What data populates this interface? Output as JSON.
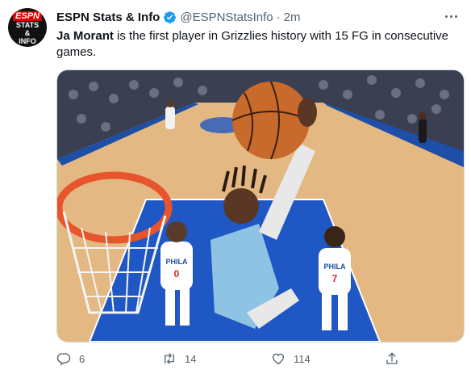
{
  "account": {
    "avatar_text_top": "ESPN",
    "avatar_text_line1": "STATS",
    "avatar_text_line2": "&",
    "avatar_text_line3": "INFO",
    "display_name": "ESPN Stats & Info",
    "handle": "@ESPNStatsInfo",
    "separator": "·",
    "timestamp": "2m",
    "verified_color": "#1d9bf0"
  },
  "tweet": {
    "mention": "Ja Morant",
    "text_rest": " is the first player in Grizzlies history with 15 FG in consecutive games."
  },
  "media": {
    "jersey_numbers": [
      "0",
      "7"
    ],
    "jersey_text": "PHILA"
  },
  "actions": {
    "reply_count": "6",
    "retweet_count": "14",
    "like_count": "114",
    "icon_color": "#536471"
  }
}
